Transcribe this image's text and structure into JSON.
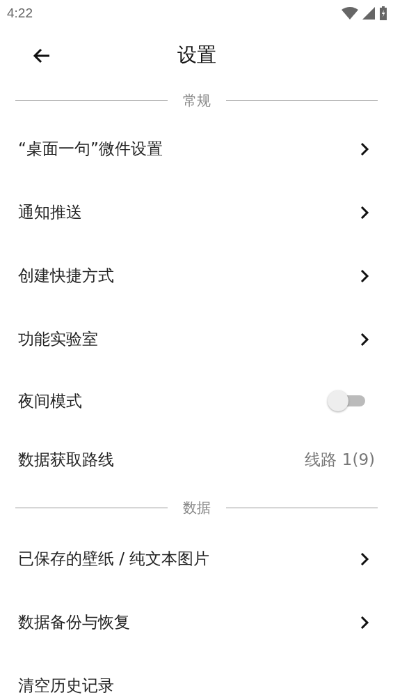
{
  "status_bar": {
    "time": "4:22"
  },
  "toolbar": {
    "title": "设置"
  },
  "sections": [
    {
      "title": "常规",
      "items": [
        {
          "kind": "link",
          "label": "“桌面一句”微件设置"
        },
        {
          "kind": "link",
          "label": "通知推送"
        },
        {
          "kind": "link",
          "label": "创建快捷方式"
        },
        {
          "kind": "link",
          "label": "功能实验室"
        },
        {
          "kind": "toggle",
          "label": "夜间模式",
          "on": false
        },
        {
          "kind": "value",
          "label": "数据获取路线",
          "value": "线路 1(9)"
        }
      ]
    },
    {
      "title": "数据",
      "items": [
        {
          "kind": "link",
          "label": "已保存的壁纸 / 纯文本图片"
        },
        {
          "kind": "link",
          "label": "数据备份与恢复"
        },
        {
          "kind": "plain",
          "label": "清空历史记录"
        }
      ]
    }
  ]
}
